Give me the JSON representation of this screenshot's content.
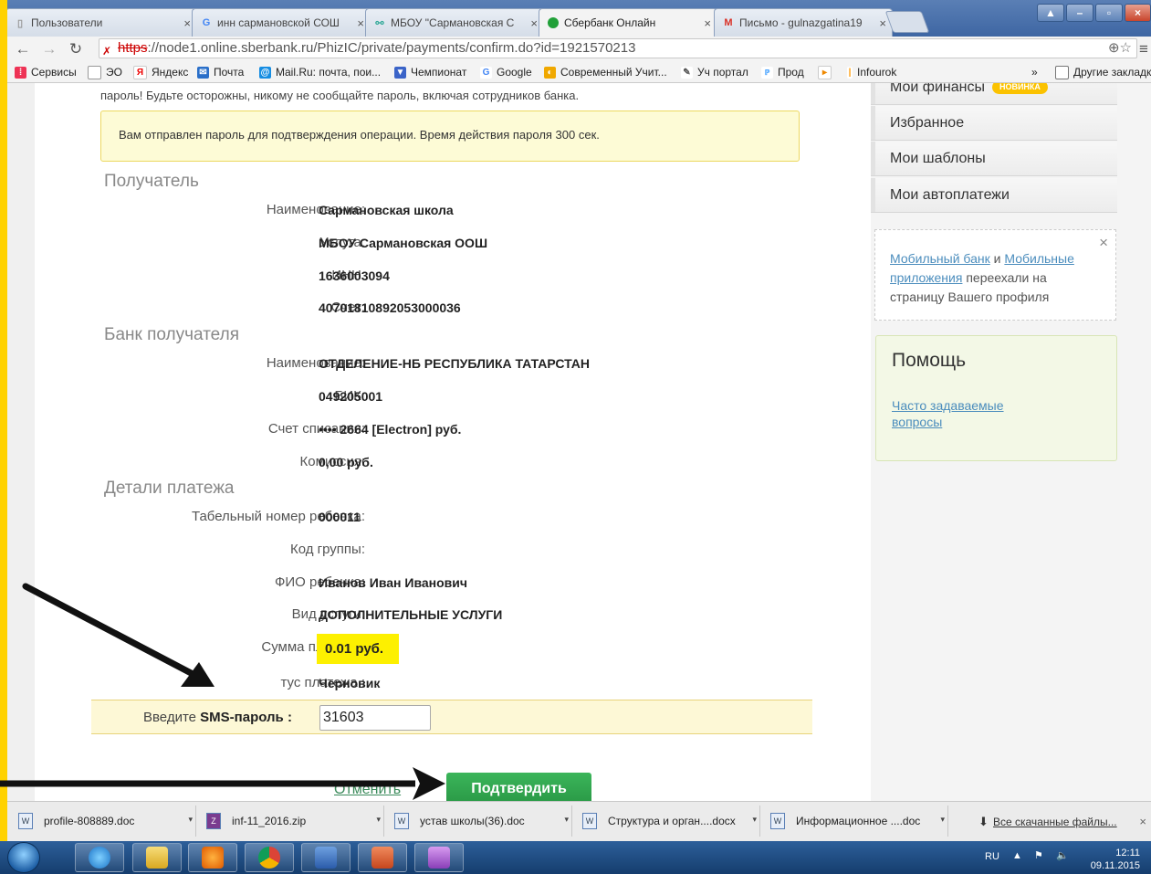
{
  "browser": {
    "tabs": [
      {
        "title": "Пользователи",
        "icon": "page-icon"
      },
      {
        "title": "инн сармановской СОШ",
        "icon": "google-icon"
      },
      {
        "title": "МБОУ \"Сармановская С",
        "icon": "share-icon"
      },
      {
        "title": "Сбербанк Онлайн",
        "icon": "sberbank-icon"
      },
      {
        "title": "Письмо - gulnazgatina19",
        "icon": "gmail-icon"
      }
    ],
    "url_scheme": "https",
    "url_rest": "://node1.online.sberbank.ru/PhizIC/private/payments/confirm.do?id=1921570213",
    "bookmarks": [
      "Сервисы",
      "ЭО",
      "Яндекс",
      "Почта",
      "Mail.Ru: почта, пои...",
      "Чемпионат",
      "Google",
      "Современный Учит...",
      "Уч портал",
      "Прод",
      "",
      "Infourok"
    ],
    "other_bookmarks": "Другие закладк",
    "more": "»"
  },
  "payment": {
    "warning_text": "пароль! Будьте осторожны, никому не сообщайте пароль, включая сотрудников банка.",
    "notice_text": "Вам отправлен пароль для подтверждения операции. Время действия пароля 300 сек.",
    "sections": {
      "recipient": "Получатель",
      "bank": "Банк получателя",
      "details": "Детали платежа"
    },
    "recipient": [
      {
        "label": "Наименование:",
        "value": "Сармановская школа"
      },
      {
        "label": "Услуга:",
        "value": "МБОУ Сармановская ООШ"
      },
      {
        "label": "ИНН:",
        "value": "1636003094"
      },
      {
        "label": "Счет:",
        "value": "40701810892053000036"
      }
    ],
    "bank": [
      {
        "label": "Наименование:",
        "value": "ОТДЕЛЕНИЕ-НБ РЕСПУБЛИКА ТАТАРСТАН"
      },
      {
        "label": "БИК:",
        "value": "049205001"
      },
      {
        "label": "Счет списания:",
        "value": "•••• 2664  [Electron]  руб."
      },
      {
        "label": "Комиссия:",
        "value": "0,00 руб."
      }
    ],
    "details": [
      {
        "label": "Табельный номер ребенка:",
        "value": "000011"
      },
      {
        "label": "Код группы:",
        "value": ""
      },
      {
        "label": "ФИО ребенка:",
        "value": "Иванов Иван Иванович"
      },
      {
        "label": "Вид услуги:",
        "value": "ДОПОЛНИТЕЛЬНЫЕ УСЛУГИ"
      }
    ],
    "amount_label": "Сумма платежа:",
    "amount_value": "0.01 руб.",
    "status_label": "тус платежа :",
    "status_value": "Черновик",
    "sms_label_prefix": "Введите ",
    "sms_label_bold": "SMS-пароль :",
    "sms_value": "31603",
    "cancel_label": "Отменить",
    "confirm_label": "Подтвердить"
  },
  "sidebar": {
    "menu": [
      {
        "label": "Мои финансы",
        "badge": "НОВИНКА"
      },
      {
        "label": "Избранное"
      },
      {
        "label": "Мои шаблоны"
      },
      {
        "label": "Мои автоплатежи"
      }
    ],
    "info": {
      "link1": "Мобильный банк",
      "and": " и ",
      "link2": "Мобильные приложения",
      "rest": " переехали на страницу Вашего профиля",
      "close": "×"
    },
    "help": {
      "title": "Помощь",
      "link": "Часто задаваемые вопросы"
    }
  },
  "downloads": {
    "items": [
      "profile-808889.doc",
      "inf-11_2016.zip",
      "устав школы(36).doc",
      "Структура и орган....docx",
      "Информационное ....doc"
    ],
    "all": "Все скачанные файлы...",
    "close": "×"
  },
  "taskbar": {
    "lang": "RU",
    "time": "12:11",
    "date": "09.11.2015"
  },
  "colors": {
    "accent_green": "#2a9946",
    "highlight_yellow": "#fdf000",
    "border_yellow": "#ffd200",
    "link_blue": "#4b8dbd"
  }
}
